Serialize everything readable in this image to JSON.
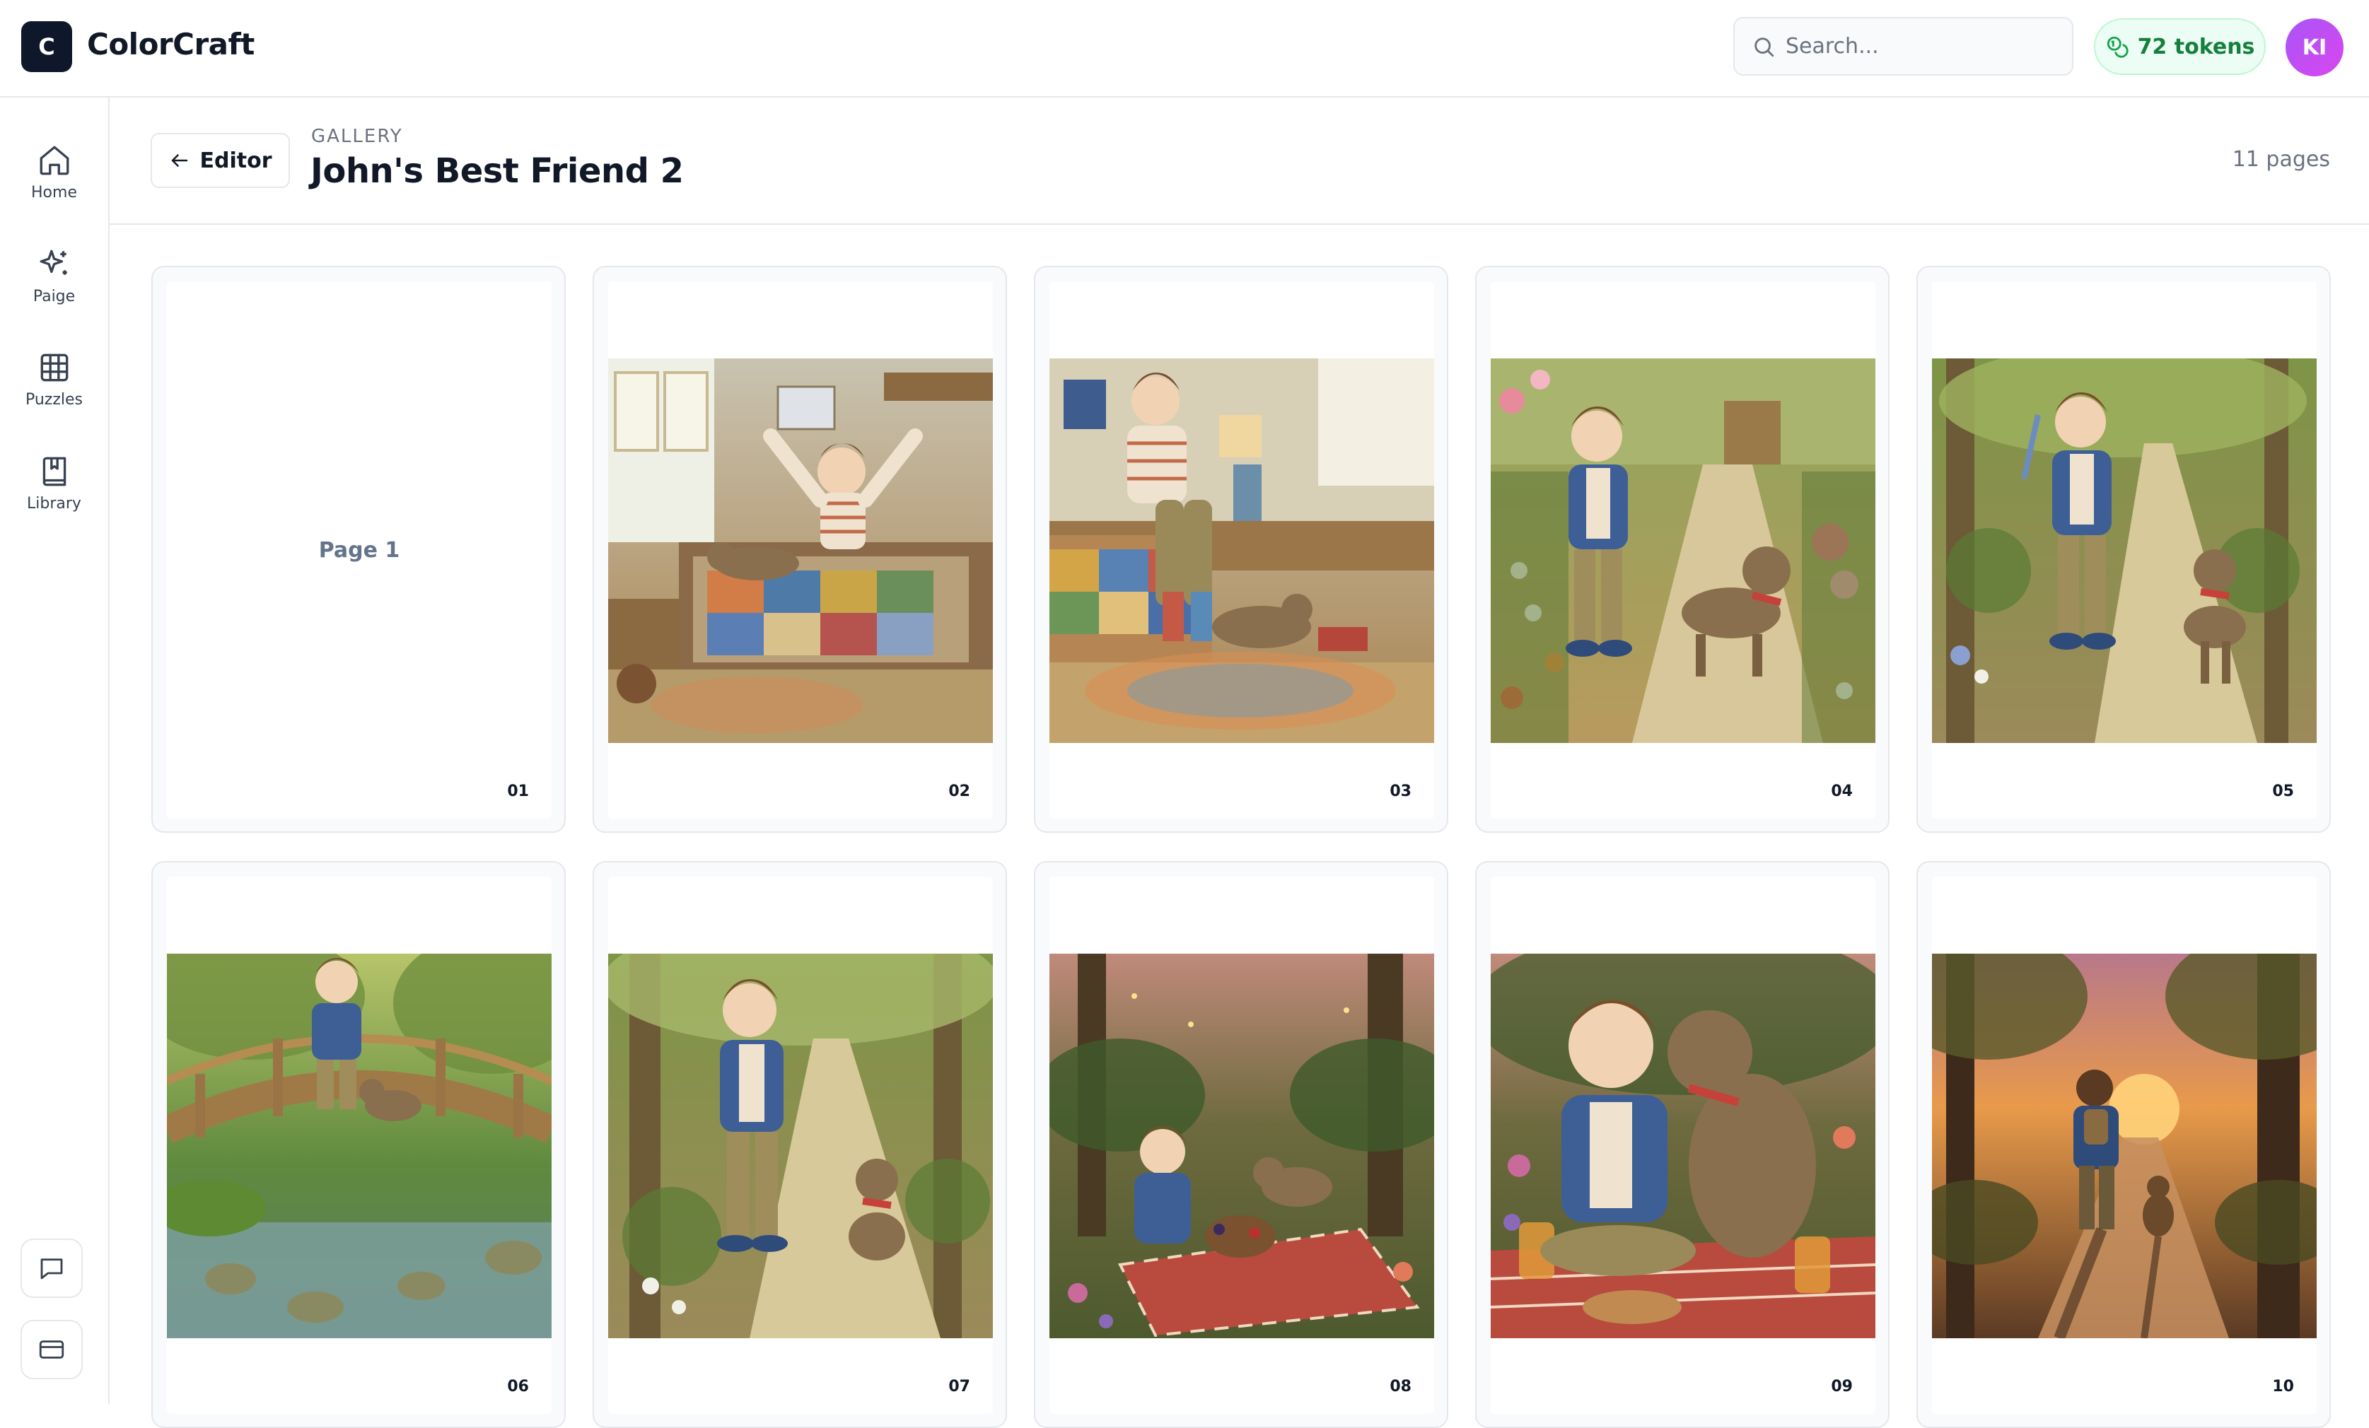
{
  "app": {
    "logo_letter": "C",
    "name": "ColorCraft"
  },
  "header_bar": {
    "search_placeholder": "Search...",
    "tokens_label": "72 tokens",
    "avatar_initials": "KI"
  },
  "sidebar": {
    "items": [
      {
        "label": "Home",
        "icon": "home-icon"
      },
      {
        "label": "Paige",
        "icon": "sparkles-icon"
      },
      {
        "label": "Puzzles",
        "icon": "grid-icon"
      },
      {
        "label": "Library",
        "icon": "book-icon"
      }
    ],
    "bottom_buttons": [
      {
        "icon": "message-icon"
      },
      {
        "icon": "card-icon"
      }
    ]
  },
  "page": {
    "back_label": "Editor",
    "eyebrow": "GALLERY",
    "title": "John's Best Friend 2",
    "page_count": "11 pages"
  },
  "gallery": {
    "placeholder_label": "Page 1",
    "pages": [
      {
        "number": "01",
        "scene": "placeholder"
      },
      {
        "number": "02",
        "scene": "bedroom-waking"
      },
      {
        "number": "03",
        "scene": "bedroom-socks"
      },
      {
        "number": "04",
        "scene": "garden-path"
      },
      {
        "number": "05",
        "scene": "forest-path-feather"
      },
      {
        "number": "06",
        "scene": "bridge-stream"
      },
      {
        "number": "07",
        "scene": "forest-walk"
      },
      {
        "number": "08",
        "scene": "picnic-dusk"
      },
      {
        "number": "09",
        "scene": "picnic-laugh"
      },
      {
        "number": "10",
        "scene": "sunset-walk"
      }
    ]
  },
  "colors": {
    "brand_dark": "#0f172a",
    "token_green": "#15803d",
    "avatar_purple": "#a855f7",
    "border": "#e5e7eb"
  }
}
